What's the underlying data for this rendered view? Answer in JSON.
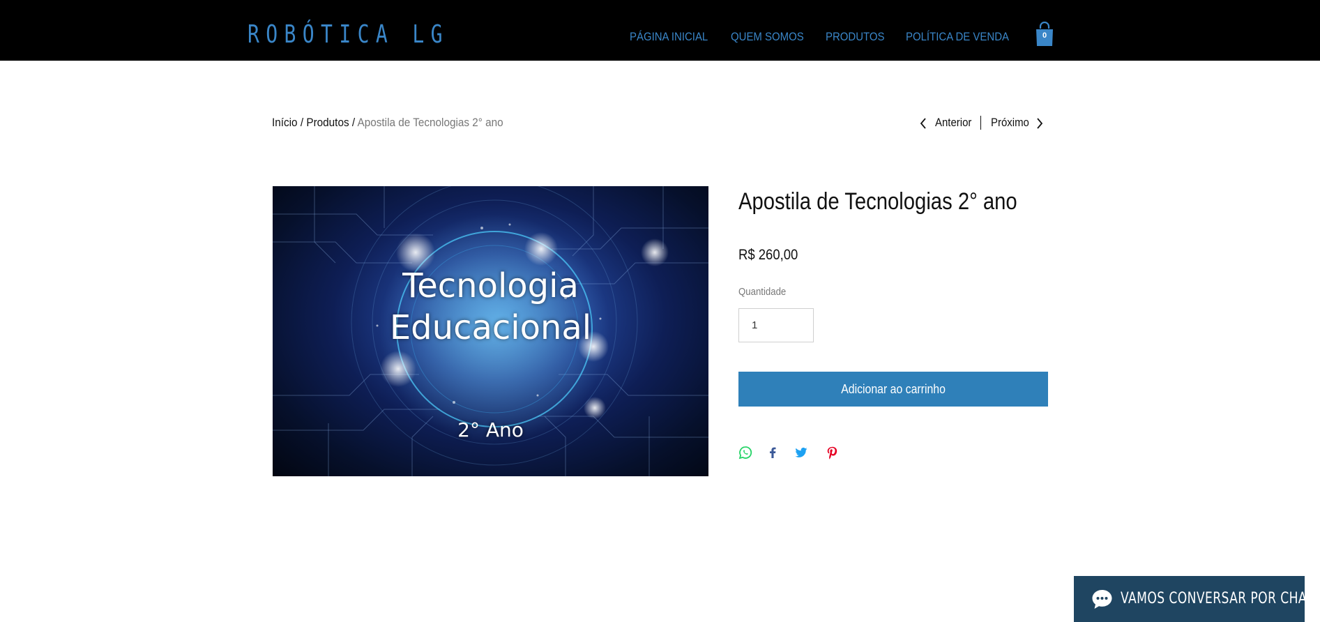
{
  "header": {
    "logo": "ROBÓTICA LG",
    "nav": [
      {
        "label": "PÁGINA INICIAL"
      },
      {
        "label": "QUEM SOMOS"
      },
      {
        "label": "PRODUTOS"
      },
      {
        "label": "POLÍTICA DE VENDA"
      }
    ],
    "cart_count": "0",
    "cart_icon": "shopping-bag-icon"
  },
  "breadcrumb": {
    "home": "Início",
    "separator": "/",
    "products": "Produtos",
    "current": "Apostila de Tecnologias 2° ano"
  },
  "pager": {
    "previous": "Anterior",
    "next": "Próximo"
  },
  "product_image": {
    "title_line1": "Tecnologia",
    "title_line2": "Educacional",
    "subtitle": "2° Ano"
  },
  "product": {
    "title": "Apostila de Tecnologias 2° ano",
    "price": "R$ 260,00",
    "quantity_label": "Quantidade",
    "quantity_value": "1",
    "add_to_cart": "Adicionar ao carrinho"
  },
  "share": [
    {
      "icon": "whatsapp-icon",
      "color": "#25d366"
    },
    {
      "icon": "facebook-icon",
      "color": "#3b5998"
    },
    {
      "icon": "twitter-icon",
      "color": "#1da1f2"
    },
    {
      "icon": "pinterest-icon",
      "color": "#e60023"
    }
  ],
  "chat": {
    "label": "VAMOS CONVERSAR POR CHAT",
    "icon": "chat-bubble-icon"
  },
  "colors": {
    "header_bg": "#000000",
    "accent": "#3a86c8",
    "button": "#2f80b9",
    "chat_bg": "#1f4561"
  }
}
